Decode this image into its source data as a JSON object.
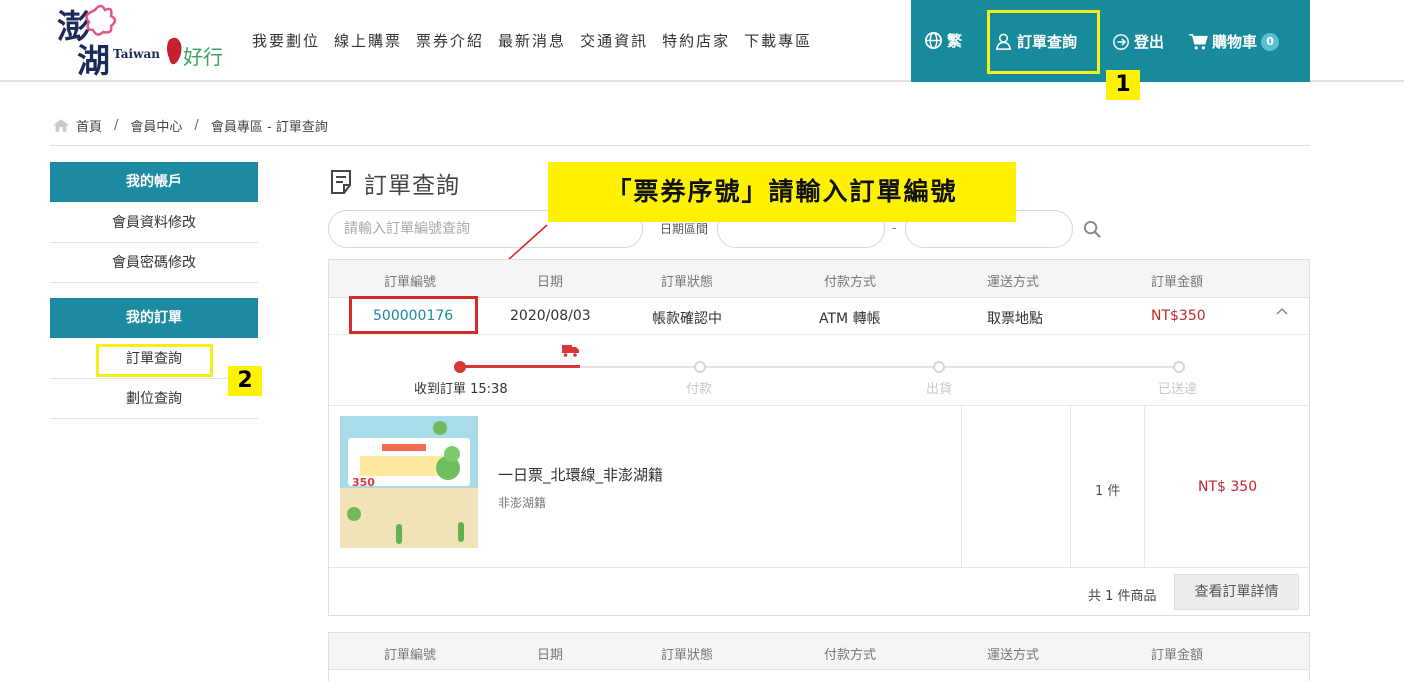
{
  "header": {
    "logo_text": "Taiwan",
    "nav": [
      "我要劃位",
      "線上購票",
      "票券介紹",
      "最新消息",
      "交通資訊",
      "特約店家",
      "下載專區"
    ],
    "lang": "繁",
    "order_query": "訂單查詢",
    "login": "登出",
    "cart": "購物車",
    "cart_count": "0",
    "accent_color": "#178a9c"
  },
  "annotations": {
    "step1": "1",
    "step2": "2",
    "callout": "「票券序號」請輸入訂單編號"
  },
  "breadcrumb": [
    "首頁",
    "會員中心",
    "會員專區 - 訂單查詢"
  ],
  "sidebar": {
    "account_title": "我的帳戶",
    "account_items": [
      "會員資料修改",
      "會員密碼修改"
    ],
    "orders_title": "我的訂單",
    "order_items": [
      "訂單查詢",
      "劃位查詢"
    ]
  },
  "main": {
    "title": "訂單查詢",
    "search_placeholder": "請輸入訂單編號查詢",
    "date_label": "日期區間",
    "date_sep": "-",
    "columns": [
      "訂單編號",
      "日期",
      "訂單狀態",
      "付款方式",
      "運送方式",
      "訂單金額"
    ],
    "order": {
      "number": "500000176",
      "date": "2020/08/03",
      "status": "帳款確認中",
      "payment": "ATM 轉帳",
      "shipping": "取票地點",
      "amount": "NT$350"
    },
    "progress": {
      "steps": [
        "收到訂單 15:38",
        "付款",
        "出貨",
        "已送達"
      ],
      "completed": 1
    },
    "item": {
      "name": "一日票_北環線_非澎湖籍",
      "sub": "非澎湖籍",
      "qty": "1 件",
      "price": "NT$ 350",
      "thumb_price": "350"
    },
    "footer": {
      "total": "共 1 件商品",
      "detail_button": "查看訂單詳情"
    }
  }
}
